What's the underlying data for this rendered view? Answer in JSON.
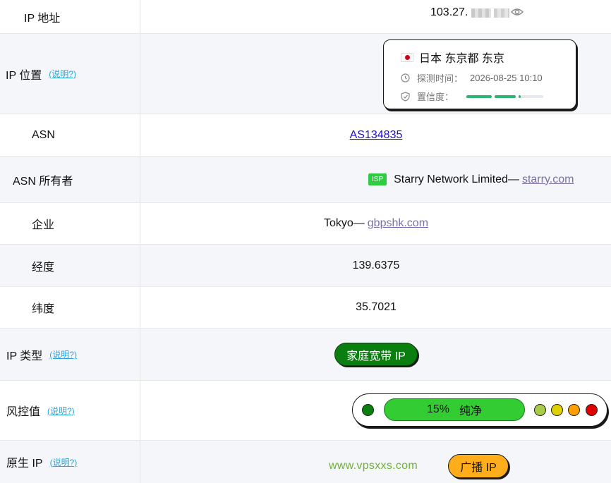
{
  "rows": {
    "ip": {
      "label": "IP 地址",
      "value": "103.27."
    },
    "location": {
      "label": "IP 位置",
      "help": "(说明?)",
      "place": "日本 东京都 东京",
      "probe_label": "探测时间：",
      "probe_time": "2026-08-25 10:10",
      "confidence_label": "置信度："
    },
    "asn": {
      "label": "ASN",
      "value": "AS134835"
    },
    "asn_owner": {
      "label": "ASN 所有者",
      "badge": "ISP",
      "name": "Starry Network Limited—",
      "domain": "starry.com"
    },
    "enterprise": {
      "label": "企业",
      "name": "Tokyo—",
      "domain": "gbpshk.com"
    },
    "longitude": {
      "label": "经度",
      "value": "139.6375"
    },
    "latitude": {
      "label": "纬度",
      "value": "35.7021"
    },
    "ip_type": {
      "label": "IP 类型",
      "help": "(说明?)",
      "value": "家庭宽带 IP"
    },
    "risk": {
      "label": "风控值",
      "help": "(说明?)",
      "percent": "15%",
      "status": "纯净"
    },
    "native": {
      "label": "原生 IP",
      "help": "(说明?)",
      "watermark": "www.vpsxxs.com",
      "value": "广播 IP"
    }
  },
  "colors": {
    "risk_dots": [
      "#0a7f10",
      "#a8cc4a",
      "#e0d000",
      "#ff9f00",
      "#e00000"
    ],
    "confidence": "#2bb673"
  }
}
